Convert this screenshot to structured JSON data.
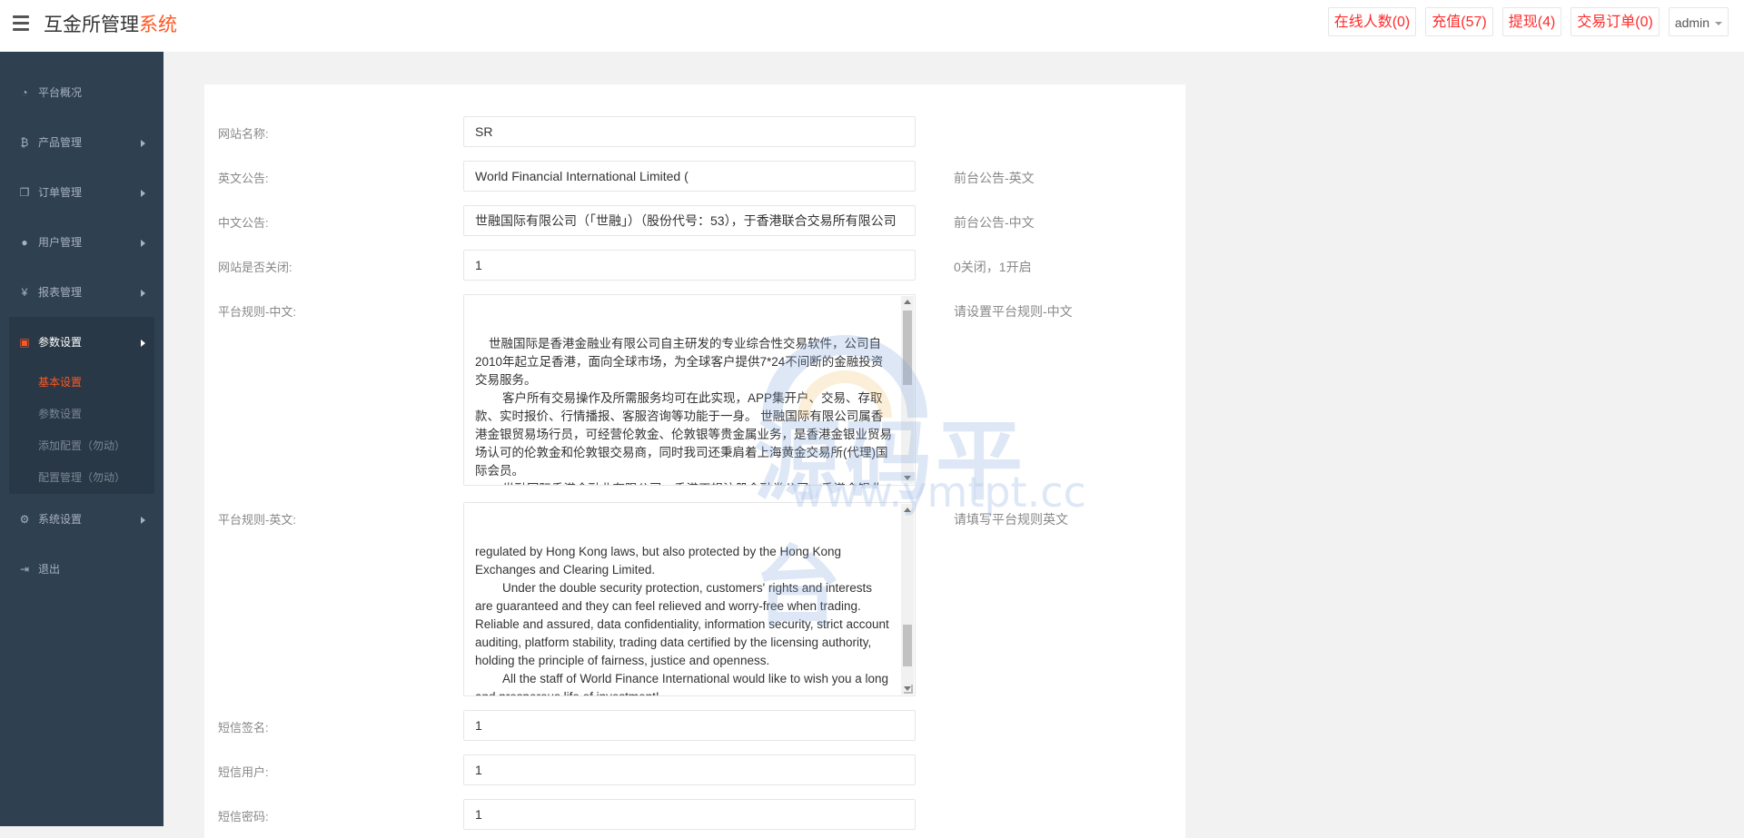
{
  "header": {
    "logo_main": "互金所管理",
    "logo_accent": "系统",
    "buttons": {
      "online": "在线人数(0)",
      "recharge": "充值(57)",
      "withdraw": "提现(4)",
      "orders": "交易订单(0)",
      "admin": "admin"
    }
  },
  "sidebar": {
    "items": [
      {
        "label": "平台概况",
        "icon": "dashboard-icon"
      },
      {
        "label": "产品管理",
        "icon": "bitcoin-icon"
      },
      {
        "label": "订单管理",
        "icon": "copy-icon"
      },
      {
        "label": "用户管理",
        "icon": "user-icon"
      },
      {
        "label": "报表管理",
        "icon": "yen-icon"
      },
      {
        "label": "参数设置",
        "icon": "paste-icon"
      },
      {
        "label": "系统设置",
        "icon": "gears-icon"
      },
      {
        "label": "退出",
        "icon": "sign-out-icon"
      }
    ],
    "sub_items": [
      "基本设置",
      "参数设置",
      "添加配置（勿动）",
      "配置管理（勿动）"
    ]
  },
  "form": {
    "site_name": {
      "label": "网站名称:",
      "value": "SR"
    },
    "en_notice": {
      "label": "英文公告:",
      "value": "World Financial International Limited (",
      "hint": "前台公告-英文"
    },
    "cn_notice": {
      "label": "中文公告:",
      "value": "世融国际有限公司（「世融」）（股份代号：53），于香港联合交易所有限公司",
      "hint": "前台公告-中文"
    },
    "site_closed": {
      "label": "网站是否关闭:",
      "value": "1",
      "hint": "0关闭，1开启"
    },
    "rules_cn": {
      "label": "平台规则-中文:",
      "hint": "请设置平台规则-中文",
      "text": "    世融国际是香港金融业有限公司自主研发的专业综合性交易软件，公司自2010年起立足香港，面向全球市场，为全球客户提供7*24不间断的金融投资交易服务。\n        客户所有交易操作及所需服务均可在此实现，APP集开户、交易、存取款、实时报价、行情播报、客服咨询等功能于一身。 世融国际有限公司属香港金银贸易场行员，可经营伦敦金、伦敦银等贵金属业务，是香港金银业贸易场认可的伦敦金和伦敦银交易商，同时我司还秉肩着上海黄金交易所(代理)国际会员。\n        世融国际香港金融业有限公司，香港正规注册金融类公司，香港金银业贸易场AA类89号行员，完全合法经营伦敦金、伦敦银业务。所有业务都受"
    },
    "rules_en": {
      "label": "平台规则-英文:",
      "hint": "请填写平台规则英文",
      "text": "regulated by Hong Kong laws, but also protected by the Hong Kong Exchanges and Clearing Limited.\n        Under the double security protection, customers' rights and interests are guaranteed and they can feel relieved and worry-free when trading. Reliable and assured, data confidentiality, information security, strict account auditing, platform stability, trading data certified by the licensing authority, holding the principle of fairness, justice and openness.\n        All the staff of World Finance International would like to wish you a long and prosperous life of investment!"
    },
    "sms_sign": {
      "label": "短信签名:",
      "value": "1"
    },
    "sms_user": {
      "label": "短信用户:",
      "value": "1"
    },
    "sms_pass": {
      "label": "短信密码:",
      "value": "1"
    }
  },
  "watermark": {
    "title": "源码平台",
    "url": "www.ymtpt.cc"
  }
}
